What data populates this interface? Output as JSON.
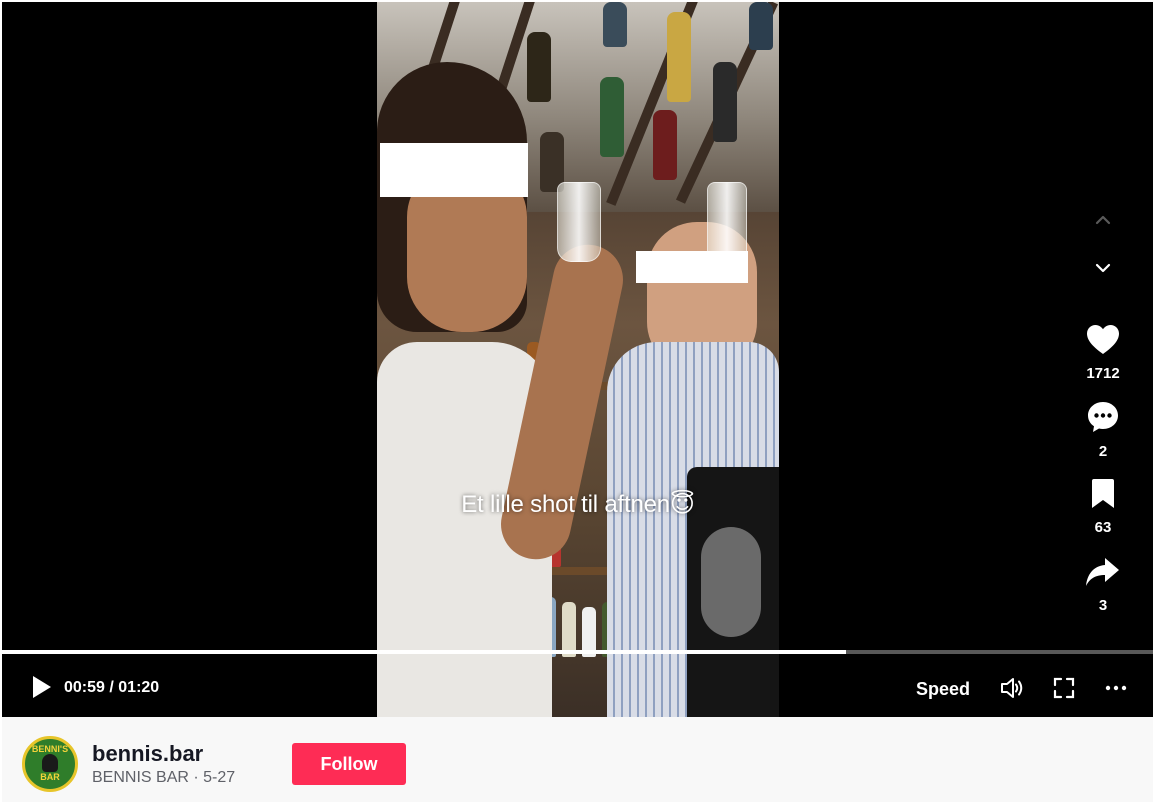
{
  "video": {
    "caption_text": "Et lille shot til aftnen",
    "caption_emoji": "😇"
  },
  "side_actions": {
    "likes": "1712",
    "comments": "2",
    "saves": "63",
    "shares": "3"
  },
  "player": {
    "current_time": "00:59",
    "separator": " / ",
    "duration": "01:20",
    "progress_fraction": 0.733,
    "speed_label": "Speed"
  },
  "author": {
    "username": "bennis.bar",
    "display_name": "BENNIS BAR",
    "dot": " · ",
    "date": "5-27",
    "avatar_text_top": "BENNI'S",
    "avatar_text_bottom": "BAR",
    "follow_label": "Follow"
  },
  "colors": {
    "accent": "#fe2c55",
    "player_bg": "#000000",
    "info_bg": "#f8f8f8"
  },
  "icons": [
    "play-icon",
    "volume-icon",
    "fullscreen-icon",
    "more-icon",
    "heart-icon",
    "comment-icon",
    "bookmark-icon",
    "share-icon",
    "chevron-up-icon",
    "chevron-down-icon"
  ]
}
